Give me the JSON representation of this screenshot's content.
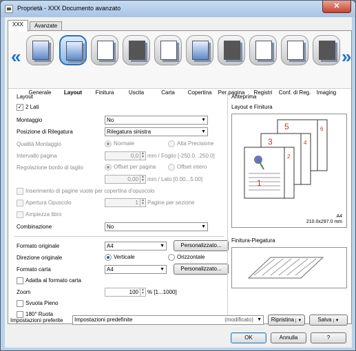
{
  "window": {
    "title": "Proprietà - XXX Documento avanzato",
    "close_label": "✕"
  },
  "tabs": [
    {
      "label": "XXX"
    },
    {
      "label": "Avanzate"
    }
  ],
  "toolbar": {
    "prev": "«",
    "next": "»",
    "items": [
      {
        "label": "Generale",
        "icon": "printer-config-icon"
      },
      {
        "label": "Layout",
        "icon": "layout-icon"
      },
      {
        "label": "Finitura",
        "icon": "finishing-icon"
      },
      {
        "label": "Uscita",
        "icon": "output-icon"
      },
      {
        "label": "Carta",
        "icon": "paper-icon"
      },
      {
        "label": "Copertina",
        "icon": "cover-icon"
      },
      {
        "label": "Per pagina",
        "icon": "paper-stack-icon"
      },
      {
        "label": "Registri",
        "icon": "index-tabs-icon"
      },
      {
        "label": "Conf. di Reg.",
        "icon": "tab-settings-icon"
      },
      {
        "label": "Imaging",
        "icon": "imaging-icon"
      }
    ]
  },
  "layout": {
    "group_title": "Layout",
    "duplex": {
      "label": "2 Lati",
      "checked": "✓"
    },
    "montaggio": {
      "label": "Montaggio",
      "value": "No"
    },
    "binding": {
      "label": "Posizione di Rilegatura",
      "value": "Rilegatura sinistra"
    },
    "quality": {
      "label": "Qualità Montaggio",
      "opt1": "Normale",
      "opt2": "Alta Precisione"
    },
    "interval": {
      "label": "Intervallo pagina",
      "value": "0,0",
      "suffix": "mm / Foglio [-250.0...250.0]"
    },
    "shift": {
      "label": "Regolazione bordo di taglio",
      "opt1": "Offset per pagina",
      "opt2": "Offset intero",
      "value": "0,00",
      "suffix": "mm / Lato [0.00...5.00]"
    },
    "blank_insert": "Inserimento di pagine vuote per copertina d'opuscolo",
    "booklet_open": {
      "label": "Apertura Opuscolo",
      "value": "1",
      "suffix": "Pagine per sezione"
    },
    "booklet_width": "Ampiezza libro",
    "combination": {
      "label": "Combinazione",
      "value": "No"
    }
  },
  "paper": {
    "original_size": {
      "label": "Formato originale",
      "value": "A4",
      "button": "Personalizzato..."
    },
    "orientation": {
      "label": "Direzione originale",
      "opt1": "Verticale",
      "opt2": "Orizzontale"
    },
    "paper_size": {
      "label": "Formato carta",
      "value": "A4",
      "button": "Personalizzato..."
    },
    "fit": "Adatta al formato carta",
    "zoom": {
      "label": "Zoom",
      "value": "100",
      "suffix": "% [1...1000]"
    },
    "full_bleed": "Svuota Pieno",
    "rotate": "180° Ruota"
  },
  "preview": {
    "title": "Anteprima",
    "subtitle": "Layout e Finitura",
    "paper_name": "A4",
    "paper_size": "210.0x297.0 mm",
    "page_numbers": [
      "1",
      "2",
      "3",
      "4",
      "5",
      "6"
    ],
    "finishing_title": "Finitura-Piegatura"
  },
  "footer": {
    "favorites_label": "Impostazioni preferite",
    "favorites_value": "Impostazioni predefinite",
    "favorites_status": "(modificato)",
    "restore": "Ripristina",
    "save": "Salva",
    "ok": "OK",
    "cancel": "Annulla",
    "help": "?"
  }
}
